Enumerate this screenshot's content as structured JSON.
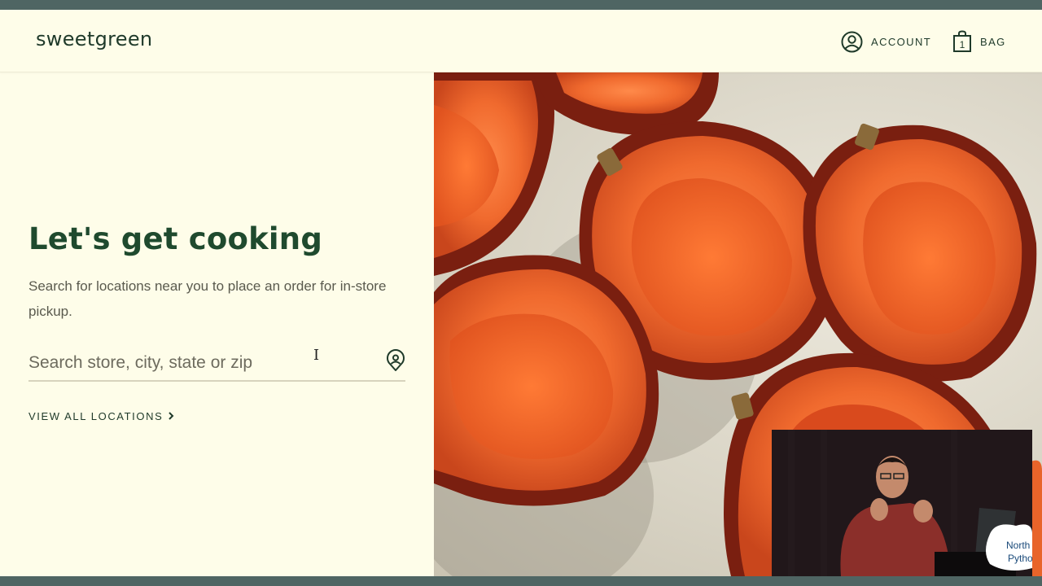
{
  "brand": {
    "logo": "sweetgreen"
  },
  "nav": {
    "account_label": "ACCOUNT",
    "bag_label": "BAG",
    "bag_count": "1"
  },
  "main": {
    "headline": "Let's get cooking",
    "subtext": "Search for locations near you to place an order for in-store pickup.",
    "search": {
      "placeholder": "Search store, city, state or zip",
      "value": ""
    },
    "view_all_label": "VIEW ALL LOCATIONS"
  },
  "video_overlay": {
    "sign_text_line1": "North",
    "sign_text_line2": "Pytho"
  },
  "icons": [
    "account-icon",
    "bag-icon",
    "location-pin-icon",
    "chevron-right-icon"
  ],
  "colors": {
    "background": "#fefde9",
    "text_dark_green": "#1f4a2e",
    "body_text": "#5a5a4e",
    "squash_orange": "#e8642a"
  }
}
